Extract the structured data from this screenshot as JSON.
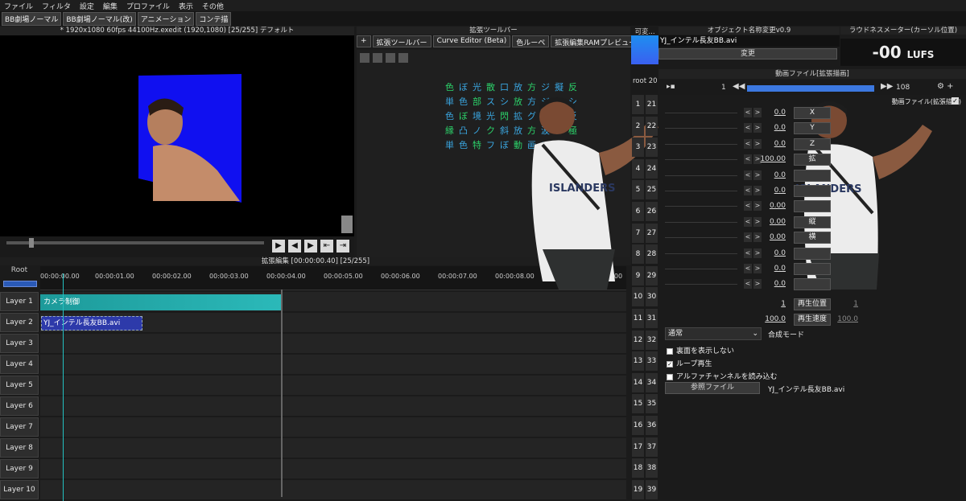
{
  "menu": [
    "ファイル",
    "フィルタ",
    "設定",
    "編集",
    "プロファイル",
    "表示",
    "その他"
  ],
  "layout_tabs": [
    "BB劇場ノーマル",
    "BB劇場ノーマル(改)",
    "アニメーション",
    "コンテ描"
  ],
  "preview_title": "* 1920x1080  60fps  44100Hz.exedit (1920,1080)  [25/255]  デフォルト",
  "timeline": {
    "title": "拡張編集 [00:00:00.40] [25/255]",
    "root_label": "Root",
    "ticks": [
      "00:00:00.00",
      "00:00:01.00",
      "00:00:02.00",
      "00:00:03.00",
      "00:00:04.00",
      "00:00:05.00",
      "00:00:06.00",
      "00:00:07.00",
      "00:00:08.00",
      "00:00"
    ],
    "layers": [
      "Layer 1",
      "Layer 2",
      "Layer 3",
      "Layer 4",
      "Layer 5",
      "Layer 6",
      "Layer 7",
      "Layer 8",
      "Layer 9",
      "Layer 10"
    ],
    "clips": {
      "camera": "カメラ制御",
      "video": "YJ_インテル長友BB.avi"
    }
  },
  "ext_toolbar": {
    "title": "拡張ツールバー",
    "tabs": [
      "+",
      "拡張ツールバー",
      "Curve Editor (Beta)",
      "色ルーペ",
      "拡張編集RAMプレビュー"
    ],
    "glyph_rows": [
      [
        "色",
        "ぼ",
        "光",
        "散",
        "口",
        "放",
        "方",
        "ジ",
        "擬",
        "反"
      ],
      [
        "単",
        "色",
        "部",
        "ス",
        "シ",
        "放",
        "方",
        "ジ",
        "フ",
        "シ"
      ],
      [
        "色",
        "ぼ",
        "境",
        "光",
        "閃",
        "拡",
        "グ",
        "ジ",
        "擬",
        "反"
      ],
      [
        "縁",
        "凸",
        "ノ",
        "ク",
        "斜",
        "放",
        "方",
        "波",
        "ジ",
        "極"
      ],
      [
        "単",
        "色",
        "特",
        "フ",
        "ぼ",
        "動",
        "画",
        "エ",
        "図",
        ""
      ]
    ]
  },
  "scene": {
    "head": "可変...",
    "root_tab": "root 20",
    "col1": [
      "1",
      "2",
      "3",
      "4",
      "5",
      "6",
      "7",
      "8",
      "9",
      "10",
      "11",
      "12",
      "13",
      "14",
      "15",
      "16",
      "17",
      "18",
      "19"
    ],
    "col2": [
      "21",
      "22",
      "23",
      "24",
      "25",
      "26",
      "27",
      "28",
      "29",
      "30",
      "31",
      "32",
      "33",
      "34",
      "35",
      "36",
      "37",
      "38",
      "39"
    ]
  },
  "object_rename": {
    "title": "オブジェクト名称変更v0.9",
    "filename": "YJ_インテル長友BB.avi",
    "change_button": "変更"
  },
  "loudness": {
    "title": "ラウドネスメーター(カーソル位置)",
    "value": "-00",
    "unit": "LUFS"
  },
  "video_props": {
    "title": "動画ファイル[拡張描画]",
    "frame_start": "1",
    "frame_end": "108",
    "filter_name": "動画ファイル(拡張描画)",
    "rows": [
      {
        "value": "0.0",
        "label": "X"
      },
      {
        "value": "0.0",
        "label": "Y"
      },
      {
        "value": "0.0",
        "label": "Z"
      },
      {
        "value": "100.00",
        "label": "拡"
      },
      {
        "value": "0.0",
        "label": ""
      },
      {
        "value": "0.0",
        "label": ""
      },
      {
        "value": "0.00",
        "label": ""
      },
      {
        "value": "0.00",
        "label": "縦"
      },
      {
        "value": "0.00",
        "label": "横"
      },
      {
        "value": "0.0",
        "label": ""
      },
      {
        "value": "0.0",
        "label": ""
      },
      {
        "value": "0.0",
        "label": ""
      }
    ],
    "playpos": {
      "value": "1",
      "label": "再生位置",
      "value2": "1"
    },
    "speed": {
      "value": "100.0",
      "label": "再生速度",
      "value2": "100.0"
    },
    "blend_mode": "通常",
    "blend_label": "合成モード",
    "checkboxes": [
      {
        "label": "裏面を表示しない",
        "checked": false
      },
      {
        "label": "ループ再生",
        "checked": true
      },
      {
        "label": "アルファチャンネルを読み込む",
        "checked": false
      }
    ],
    "ref_button": "参照ファイル",
    "ref_name": "YJ_インテル長友BB.avi"
  },
  "colors": {
    "accent_blue": "#3c78e0",
    "clip_teal": "#1d9a9a",
    "cursor": "#23c0c0",
    "preview_bg": "#1010f0"
  },
  "overlay": {
    "shirt_text": "ISLANDERS"
  }
}
